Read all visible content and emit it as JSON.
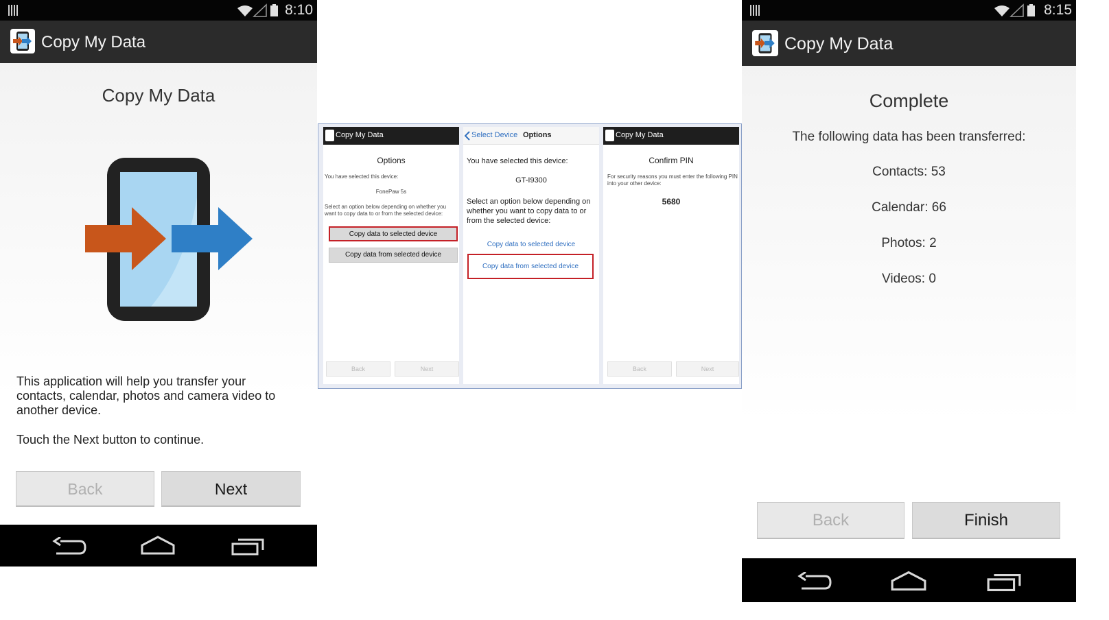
{
  "left_screen": {
    "status_time": "8:10",
    "app_title": "Copy My Data",
    "heading": "Copy My Data",
    "description": "This application will help you transfer your contacts, calendar, photos and camera video to another device.",
    "instruction": "Touch the Next button to continue.",
    "back_label": "Back",
    "next_label": "Next"
  },
  "middle": {
    "options_screen": {
      "app_title": "Copy My Data",
      "heading": "Options",
      "selected_label": "You have selected this device:",
      "device_name": "FonePaw 5s",
      "prompt": "Select an option below depending on whether you want to copy data to or from the selected device:",
      "copy_to_label": "Copy data to selected device",
      "copy_from_label": "Copy data from selected device",
      "back_label": "Back",
      "next_label": "Next"
    },
    "device_screen": {
      "nav_back": "Select Device",
      "nav_title": "Options",
      "selected_label": "You have selected this device:",
      "device_name": "GT-I9300",
      "prompt": "Select an option below depending on whether you want to copy data to or from the selected device:",
      "copy_to_label": "Copy data to selected device",
      "copy_from_label": "Copy data from selected device"
    },
    "pin_screen": {
      "app_title": "Copy My Data",
      "heading": "Confirm PIN",
      "note": "For security reasons you must enter the following PIN into your other device:",
      "pin": "5680",
      "back_label": "Back",
      "next_label": "Next"
    }
  },
  "right_screen": {
    "status_time": "8:15",
    "app_title": "Copy My Data",
    "heading": "Complete",
    "summary": "The following data has been transferred:",
    "stats": [
      "Contacts: 53",
      "Calendar: 66",
      "Photos: 2",
      "Videos: 0"
    ],
    "back_label": "Back",
    "finish_label": "Finish"
  },
  "colors": {
    "arrow_orange": "#c8561b",
    "arrow_blue": "#2f7fc6",
    "screen_blue": "#a9d6f2",
    "highlight_red": "#c42026",
    "link_blue": "#2f6fc0"
  }
}
